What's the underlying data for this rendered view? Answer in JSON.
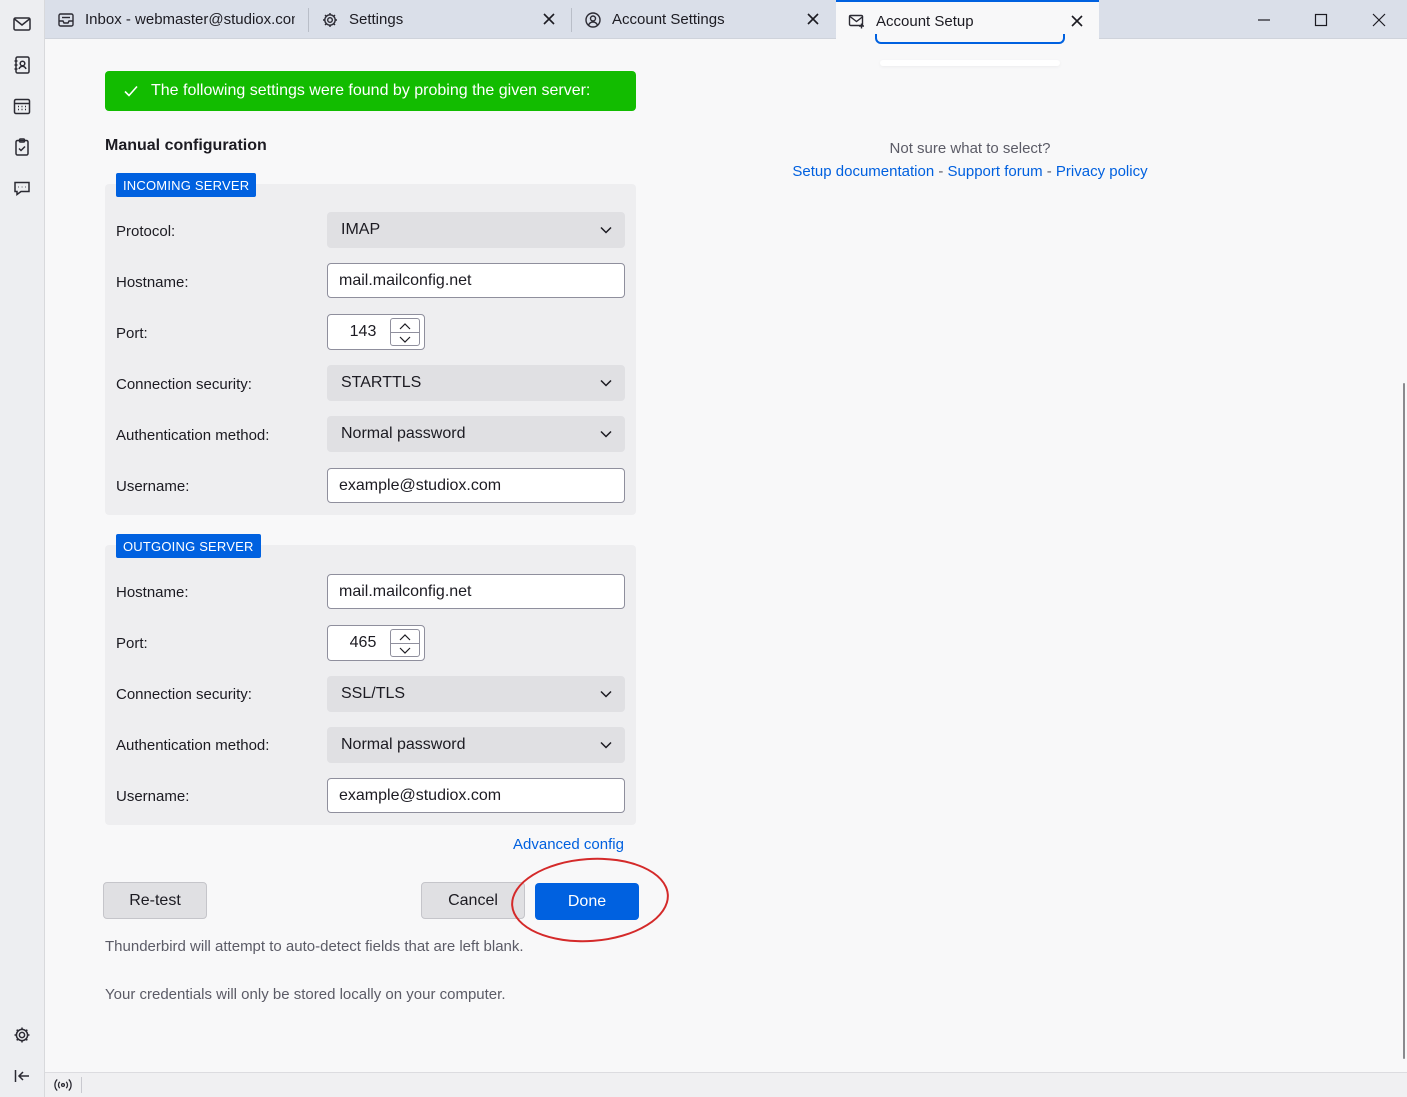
{
  "tabs": [
    {
      "label": "Inbox - webmaster@studiox.com",
      "icon": "inbox-icon"
    },
    {
      "label": "Settings",
      "icon": "gear-icon"
    },
    {
      "label": "Account Settings",
      "icon": "account-icon"
    },
    {
      "label": "Account Setup",
      "icon": "mail-setup-icon"
    }
  ],
  "banner": {
    "text": "The following settings were found by probing the given server:",
    "color": "#12bc00"
  },
  "manual": {
    "title": "Manual configuration"
  },
  "incoming": {
    "legend": "INCOMING SERVER",
    "protocol_label": "Protocol:",
    "protocol": "IMAP",
    "hostname_label": "Hostname:",
    "hostname": "mail.mailconfig.net",
    "port_label": "Port:",
    "port": "143",
    "security_label": "Connection security:",
    "security": "STARTTLS",
    "auth_label": "Authentication method:",
    "auth": "Normal password",
    "username_label": "Username:",
    "username": "example@studiox.com"
  },
  "outgoing": {
    "legend": "OUTGOING SERVER",
    "hostname_label": "Hostname:",
    "hostname": "mail.mailconfig.net",
    "port_label": "Port:",
    "port": "465",
    "security_label": "Connection security:",
    "security": "SSL/TLS",
    "auth_label": "Authentication method:",
    "auth": "Normal password",
    "username_label": "Username:",
    "username": "example@studiox.com"
  },
  "advanced_link": "Advanced config",
  "buttons": {
    "retest": "Re-test",
    "cancel": "Cancel",
    "done": "Done"
  },
  "notes": {
    "autodetect": "Thunderbird will attempt to auto-detect fields that are left blank.",
    "credentials": "Your credentials will only be stored locally on your computer."
  },
  "help": {
    "title": "Not sure what to select?",
    "setup_doc": "Setup documentation",
    "sep": " - ",
    "support": "Support forum",
    "privacy": "Privacy policy"
  },
  "colors": {
    "accent": "#0061e0",
    "success": "#12bc00",
    "annotation": "#d42a2a",
    "link": "#0060df"
  }
}
